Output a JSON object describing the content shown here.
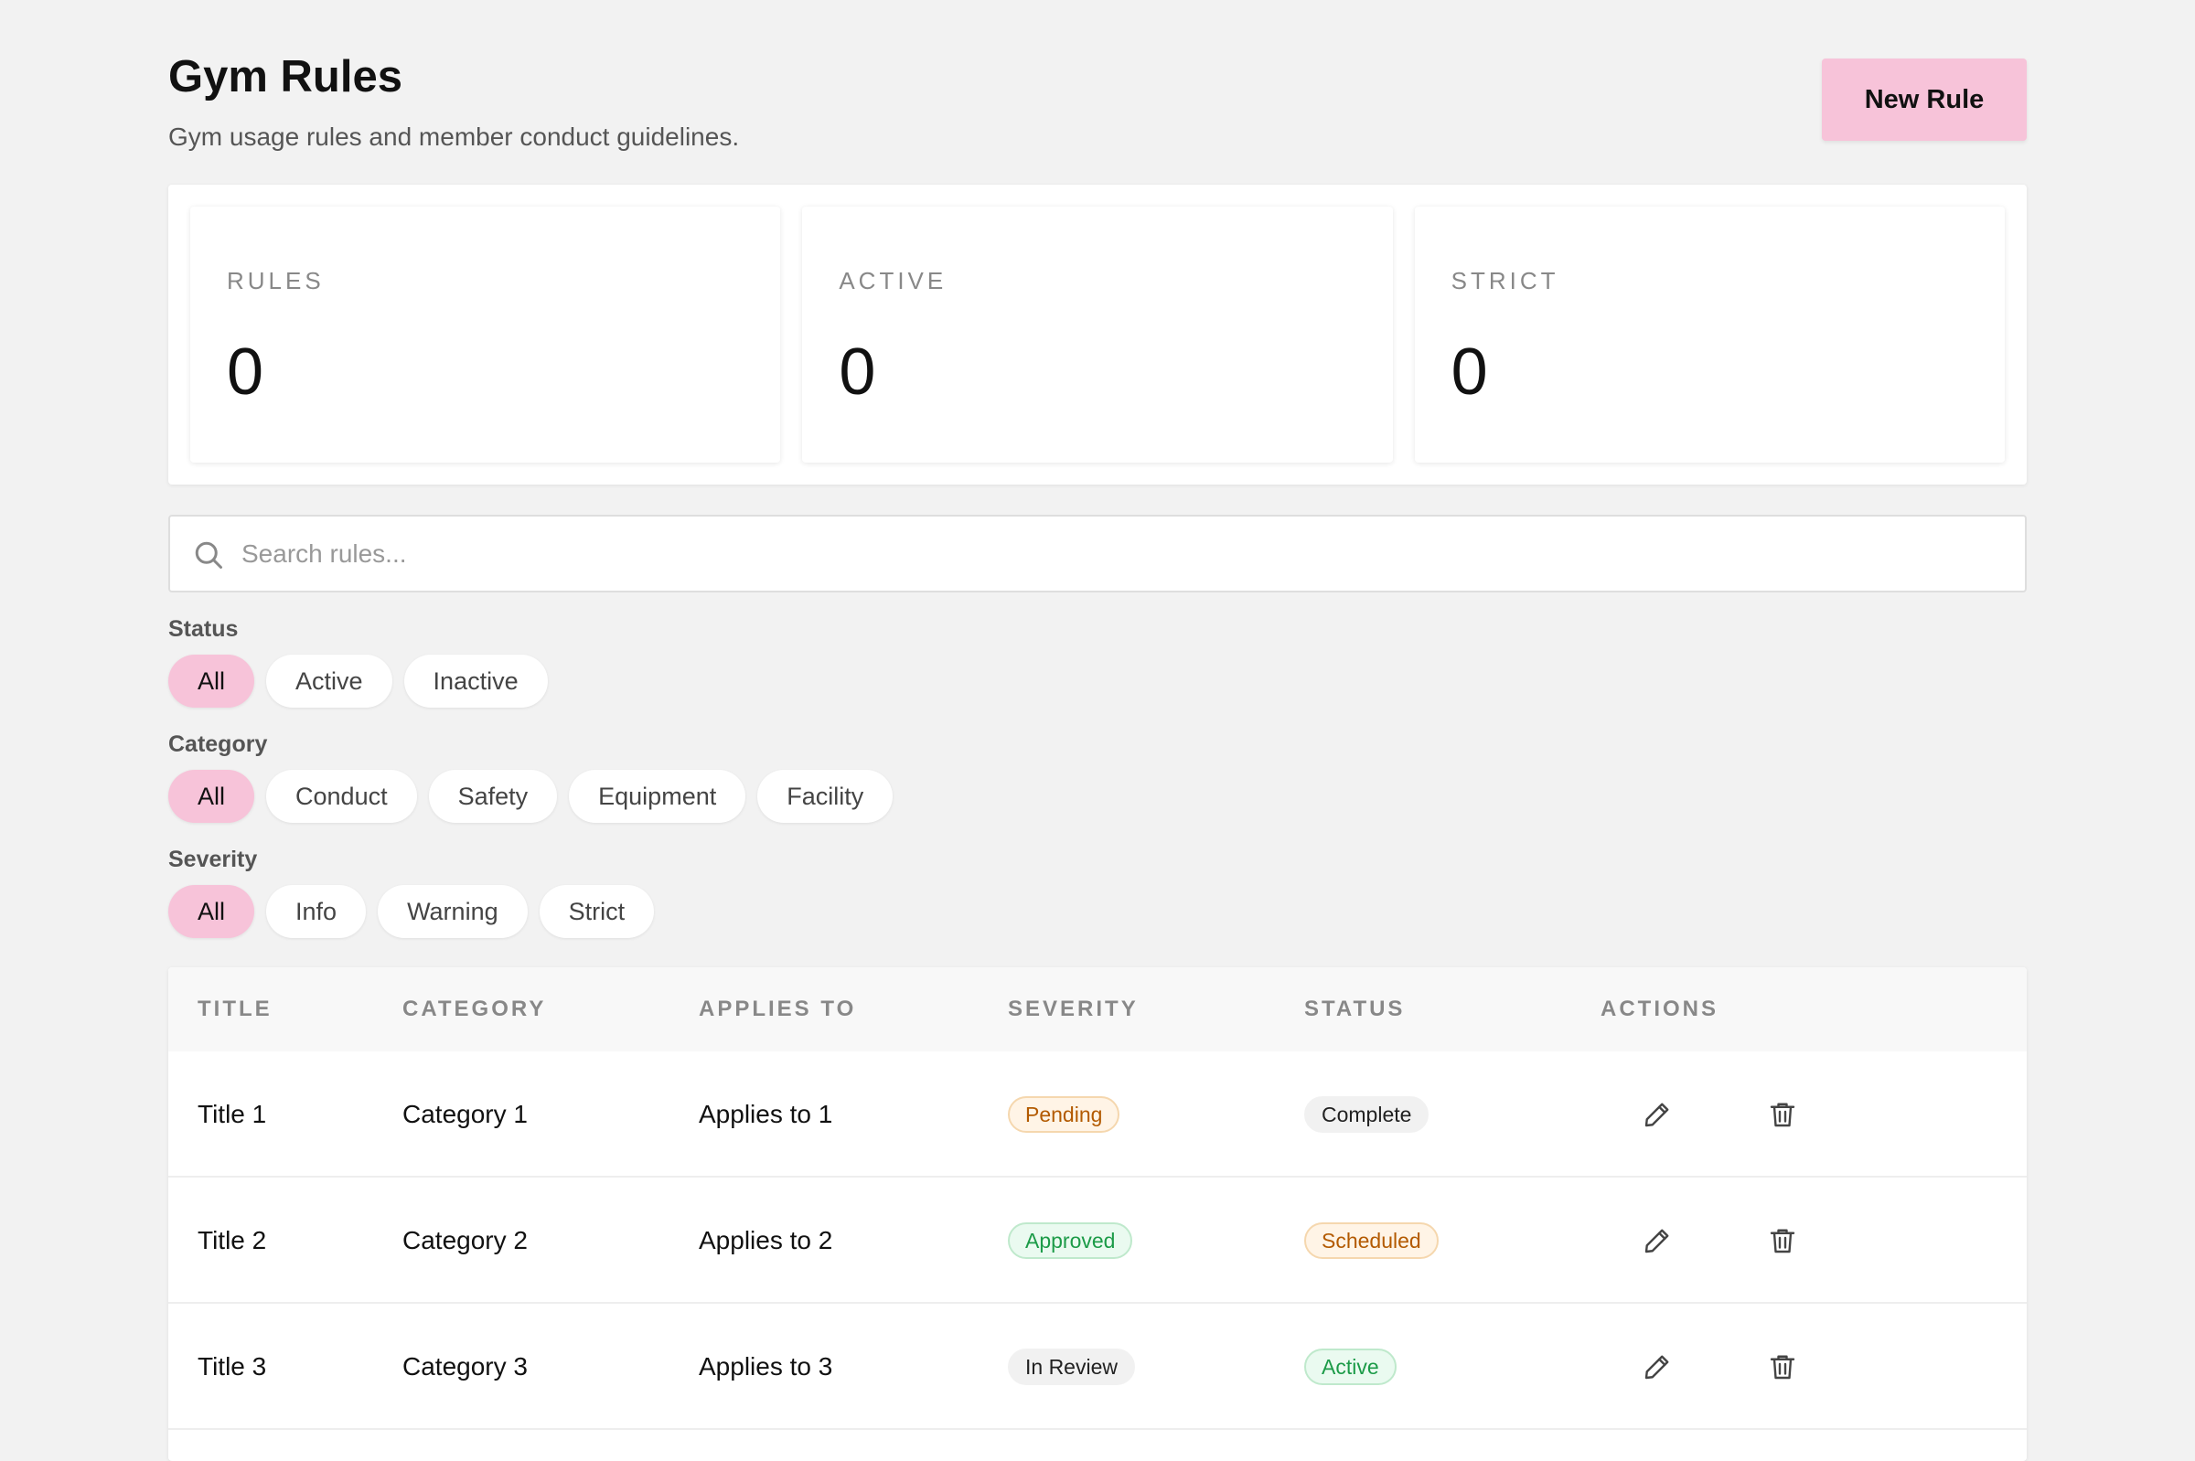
{
  "header": {
    "title": "Gym Rules",
    "subtitle": "Gym usage rules and member conduct guidelines.",
    "new_button": "New Rule"
  },
  "stats": [
    {
      "label": "RULES",
      "value": "0"
    },
    {
      "label": "ACTIVE",
      "value": "0"
    },
    {
      "label": "STRICT",
      "value": "0"
    }
  ],
  "search": {
    "placeholder": "Search rules...",
    "value": ""
  },
  "filters": {
    "status": {
      "label": "Status",
      "options": [
        "All",
        "Active",
        "Inactive"
      ],
      "selected": "All"
    },
    "category": {
      "label": "Category",
      "options": [
        "All",
        "Conduct",
        "Safety",
        "Equipment",
        "Facility"
      ],
      "selected": "All"
    },
    "severity": {
      "label": "Severity",
      "options": [
        "All",
        "Info",
        "Warning",
        "Strict"
      ],
      "selected": "All"
    }
  },
  "table": {
    "columns": [
      "TITLE",
      "CATEGORY",
      "APPLIES TO",
      "SEVERITY",
      "STATUS",
      "ACTIONS"
    ],
    "rows": [
      {
        "title": "Title 1",
        "category": "Category 1",
        "applies_to": "Applies to 1",
        "severity": "Pending",
        "status": "Complete"
      },
      {
        "title": "Title 2",
        "category": "Category 2",
        "applies_to": "Applies to 2",
        "severity": "Approved",
        "status": "Scheduled"
      },
      {
        "title": "Title 3",
        "category": "Category 3",
        "applies_to": "Applies to 3",
        "severity": "In Review",
        "status": "Active"
      }
    ]
  },
  "colors": {
    "accent": "#f7c3d9",
    "background": "#f2f2f2",
    "badge_amber": "#b35a00",
    "badge_green": "#1c9b48"
  },
  "icons": {
    "search": "search-icon",
    "edit": "pencil-icon",
    "delete": "trash-icon"
  }
}
